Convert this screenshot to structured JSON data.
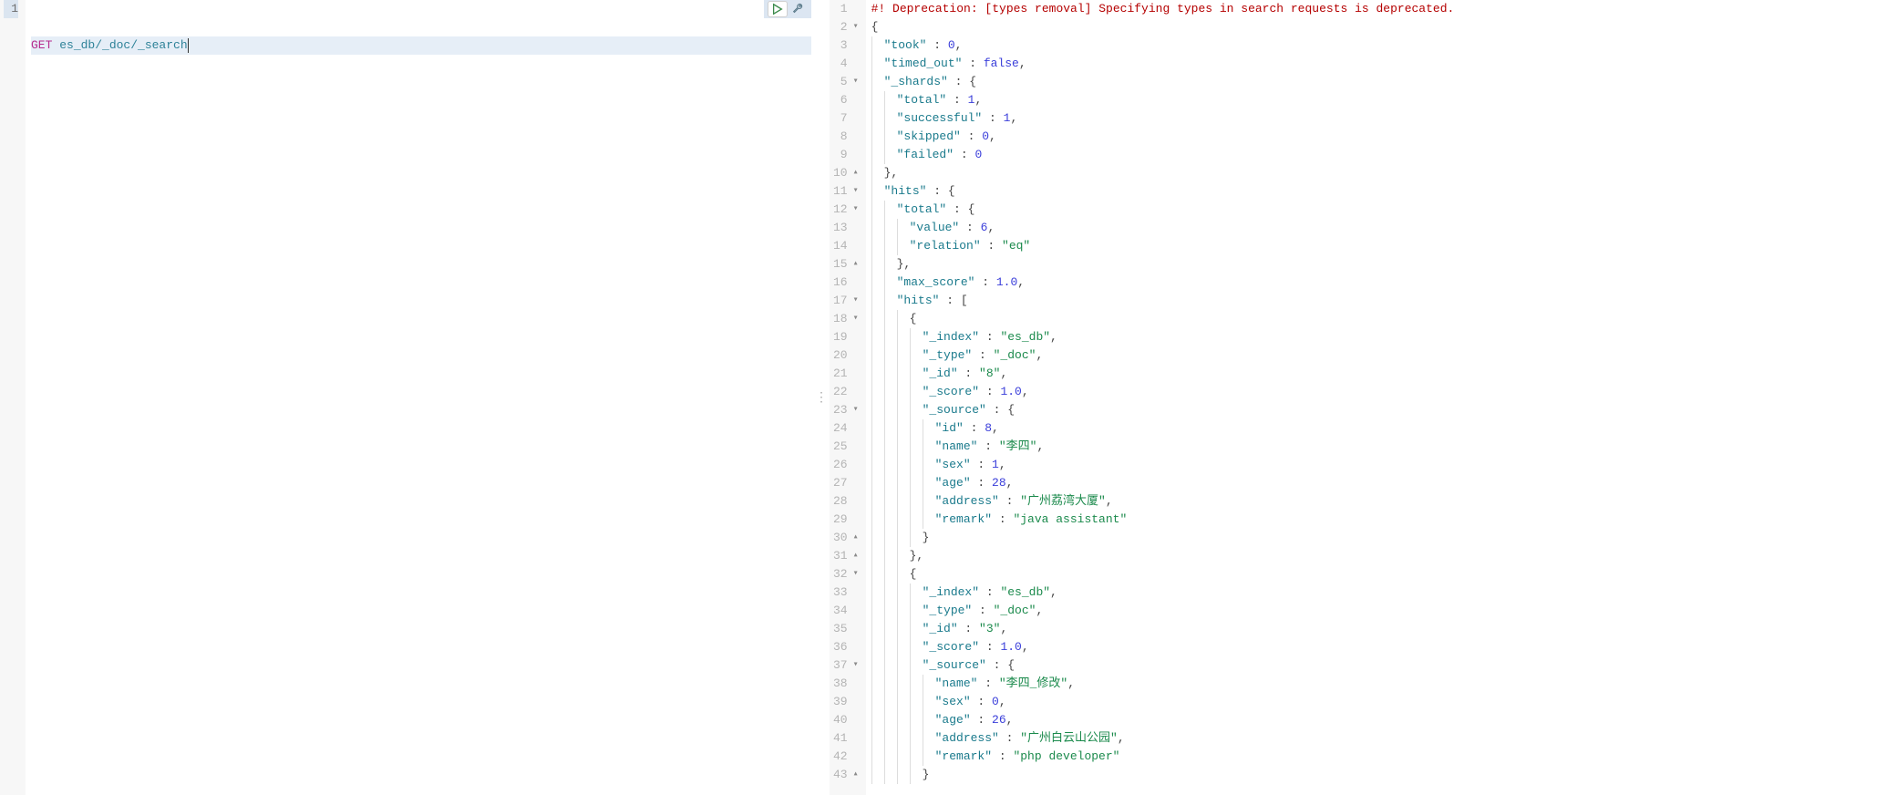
{
  "request": {
    "method": "GET",
    "path": "es_db/_doc/_search"
  },
  "actions": {
    "run": "run-request",
    "wrench": "open-options"
  },
  "responseLines": [
    {
      "n": 1,
      "fold": "",
      "indent": 0,
      "segs": [
        {
          "t": "#! Deprecation: [types removal] Specifying types in search requests is deprecated.",
          "c": "tok-err"
        }
      ]
    },
    {
      "n": 2,
      "fold": "▾",
      "indent": 0,
      "segs": [
        {
          "t": "{",
          "c": "tok-punc"
        }
      ]
    },
    {
      "n": 3,
      "fold": "",
      "indent": 1,
      "segs": [
        {
          "t": "\"took\"",
          "c": "tok-key"
        },
        {
          "t": " : ",
          "c": "tok-punc"
        },
        {
          "t": "0",
          "c": "tok-num"
        },
        {
          "t": ",",
          "c": "tok-punc"
        }
      ]
    },
    {
      "n": 4,
      "fold": "",
      "indent": 1,
      "segs": [
        {
          "t": "\"timed_out\"",
          "c": "tok-key"
        },
        {
          "t": " : ",
          "c": "tok-punc"
        },
        {
          "t": "false",
          "c": "tok-lit"
        },
        {
          "t": ",",
          "c": "tok-punc"
        }
      ]
    },
    {
      "n": 5,
      "fold": "▾",
      "indent": 1,
      "segs": [
        {
          "t": "\"_shards\"",
          "c": "tok-key"
        },
        {
          "t": " : ",
          "c": "tok-punc"
        },
        {
          "t": "{",
          "c": "tok-punc"
        }
      ]
    },
    {
      "n": 6,
      "fold": "",
      "indent": 2,
      "segs": [
        {
          "t": "\"total\"",
          "c": "tok-key"
        },
        {
          "t": " : ",
          "c": "tok-punc"
        },
        {
          "t": "1",
          "c": "tok-num"
        },
        {
          "t": ",",
          "c": "tok-punc"
        }
      ]
    },
    {
      "n": 7,
      "fold": "",
      "indent": 2,
      "segs": [
        {
          "t": "\"successful\"",
          "c": "tok-key"
        },
        {
          "t": " : ",
          "c": "tok-punc"
        },
        {
          "t": "1",
          "c": "tok-num"
        },
        {
          "t": ",",
          "c": "tok-punc"
        }
      ]
    },
    {
      "n": 8,
      "fold": "",
      "indent": 2,
      "segs": [
        {
          "t": "\"skipped\"",
          "c": "tok-key"
        },
        {
          "t": " : ",
          "c": "tok-punc"
        },
        {
          "t": "0",
          "c": "tok-num"
        },
        {
          "t": ",",
          "c": "tok-punc"
        }
      ]
    },
    {
      "n": 9,
      "fold": "",
      "indent": 2,
      "segs": [
        {
          "t": "\"failed\"",
          "c": "tok-key"
        },
        {
          "t": " : ",
          "c": "tok-punc"
        },
        {
          "t": "0",
          "c": "tok-num"
        }
      ]
    },
    {
      "n": 10,
      "fold": "▴",
      "indent": 1,
      "segs": [
        {
          "t": "}",
          "c": "tok-punc"
        },
        {
          "t": ",",
          "c": "tok-punc"
        }
      ]
    },
    {
      "n": 11,
      "fold": "▾",
      "indent": 1,
      "segs": [
        {
          "t": "\"hits\"",
          "c": "tok-key"
        },
        {
          "t": " : ",
          "c": "tok-punc"
        },
        {
          "t": "{",
          "c": "tok-punc"
        }
      ]
    },
    {
      "n": 12,
      "fold": "▾",
      "indent": 2,
      "segs": [
        {
          "t": "\"total\"",
          "c": "tok-key"
        },
        {
          "t": " : ",
          "c": "tok-punc"
        },
        {
          "t": "{",
          "c": "tok-punc"
        }
      ]
    },
    {
      "n": 13,
      "fold": "",
      "indent": 3,
      "segs": [
        {
          "t": "\"value\"",
          "c": "tok-key"
        },
        {
          "t": " : ",
          "c": "tok-punc"
        },
        {
          "t": "6",
          "c": "tok-num"
        },
        {
          "t": ",",
          "c": "tok-punc"
        }
      ]
    },
    {
      "n": 14,
      "fold": "",
      "indent": 3,
      "segs": [
        {
          "t": "\"relation\"",
          "c": "tok-key"
        },
        {
          "t": " : ",
          "c": "tok-punc"
        },
        {
          "t": "\"eq\"",
          "c": "tok-str"
        }
      ]
    },
    {
      "n": 15,
      "fold": "▴",
      "indent": 2,
      "segs": [
        {
          "t": "}",
          "c": "tok-punc"
        },
        {
          "t": ",",
          "c": "tok-punc"
        }
      ]
    },
    {
      "n": 16,
      "fold": "",
      "indent": 2,
      "segs": [
        {
          "t": "\"max_score\"",
          "c": "tok-key"
        },
        {
          "t": " : ",
          "c": "tok-punc"
        },
        {
          "t": "1.0",
          "c": "tok-num"
        },
        {
          "t": ",",
          "c": "tok-punc"
        }
      ]
    },
    {
      "n": 17,
      "fold": "▾",
      "indent": 2,
      "segs": [
        {
          "t": "\"hits\"",
          "c": "tok-key"
        },
        {
          "t": " : ",
          "c": "tok-punc"
        },
        {
          "t": "[",
          "c": "tok-punc"
        }
      ]
    },
    {
      "n": 18,
      "fold": "▾",
      "indent": 3,
      "segs": [
        {
          "t": "{",
          "c": "tok-punc"
        }
      ]
    },
    {
      "n": 19,
      "fold": "",
      "indent": 4,
      "segs": [
        {
          "t": "\"_index\"",
          "c": "tok-key"
        },
        {
          "t": " : ",
          "c": "tok-punc"
        },
        {
          "t": "\"es_db\"",
          "c": "tok-str"
        },
        {
          "t": ",",
          "c": "tok-punc"
        }
      ]
    },
    {
      "n": 20,
      "fold": "",
      "indent": 4,
      "segs": [
        {
          "t": "\"_type\"",
          "c": "tok-key"
        },
        {
          "t": " : ",
          "c": "tok-punc"
        },
        {
          "t": "\"_doc\"",
          "c": "tok-str"
        },
        {
          "t": ",",
          "c": "tok-punc"
        }
      ]
    },
    {
      "n": 21,
      "fold": "",
      "indent": 4,
      "segs": [
        {
          "t": "\"_id\"",
          "c": "tok-key"
        },
        {
          "t": " : ",
          "c": "tok-punc"
        },
        {
          "t": "\"8\"",
          "c": "tok-str"
        },
        {
          "t": ",",
          "c": "tok-punc"
        }
      ]
    },
    {
      "n": 22,
      "fold": "",
      "indent": 4,
      "segs": [
        {
          "t": "\"_score\"",
          "c": "tok-key"
        },
        {
          "t": " : ",
          "c": "tok-punc"
        },
        {
          "t": "1.0",
          "c": "tok-num"
        },
        {
          "t": ",",
          "c": "tok-punc"
        }
      ]
    },
    {
      "n": 23,
      "fold": "▾",
      "indent": 4,
      "segs": [
        {
          "t": "\"_source\"",
          "c": "tok-key"
        },
        {
          "t": " : ",
          "c": "tok-punc"
        },
        {
          "t": "{",
          "c": "tok-punc"
        }
      ]
    },
    {
      "n": 24,
      "fold": "",
      "indent": 5,
      "segs": [
        {
          "t": "\"id\"",
          "c": "tok-key"
        },
        {
          "t": " : ",
          "c": "tok-punc"
        },
        {
          "t": "8",
          "c": "tok-num"
        },
        {
          "t": ",",
          "c": "tok-punc"
        }
      ]
    },
    {
      "n": 25,
      "fold": "",
      "indent": 5,
      "segs": [
        {
          "t": "\"name\"",
          "c": "tok-key"
        },
        {
          "t": " : ",
          "c": "tok-punc"
        },
        {
          "t": "\"李四\"",
          "c": "tok-str"
        },
        {
          "t": ",",
          "c": "tok-punc"
        }
      ]
    },
    {
      "n": 26,
      "fold": "",
      "indent": 5,
      "segs": [
        {
          "t": "\"sex\"",
          "c": "tok-key"
        },
        {
          "t": " : ",
          "c": "tok-punc"
        },
        {
          "t": "1",
          "c": "tok-num"
        },
        {
          "t": ",",
          "c": "tok-punc"
        }
      ]
    },
    {
      "n": 27,
      "fold": "",
      "indent": 5,
      "segs": [
        {
          "t": "\"age\"",
          "c": "tok-key"
        },
        {
          "t": " : ",
          "c": "tok-punc"
        },
        {
          "t": "28",
          "c": "tok-num"
        },
        {
          "t": ",",
          "c": "tok-punc"
        }
      ]
    },
    {
      "n": 28,
      "fold": "",
      "indent": 5,
      "segs": [
        {
          "t": "\"address\"",
          "c": "tok-key"
        },
        {
          "t": " : ",
          "c": "tok-punc"
        },
        {
          "t": "\"广州荔湾大厦\"",
          "c": "tok-str"
        },
        {
          "t": ",",
          "c": "tok-punc"
        }
      ]
    },
    {
      "n": 29,
      "fold": "",
      "indent": 5,
      "segs": [
        {
          "t": "\"remark\"",
          "c": "tok-key"
        },
        {
          "t": " : ",
          "c": "tok-punc"
        },
        {
          "t": "\"java assistant\"",
          "c": "tok-str"
        }
      ]
    },
    {
      "n": 30,
      "fold": "▴",
      "indent": 4,
      "segs": [
        {
          "t": "}",
          "c": "tok-punc"
        }
      ]
    },
    {
      "n": 31,
      "fold": "▴",
      "indent": 3,
      "segs": [
        {
          "t": "}",
          "c": "tok-punc"
        },
        {
          "t": ",",
          "c": "tok-punc"
        }
      ]
    },
    {
      "n": 32,
      "fold": "▾",
      "indent": 3,
      "segs": [
        {
          "t": "{",
          "c": "tok-punc"
        }
      ]
    },
    {
      "n": 33,
      "fold": "",
      "indent": 4,
      "segs": [
        {
          "t": "\"_index\"",
          "c": "tok-key"
        },
        {
          "t": " : ",
          "c": "tok-punc"
        },
        {
          "t": "\"es_db\"",
          "c": "tok-str"
        },
        {
          "t": ",",
          "c": "tok-punc"
        }
      ]
    },
    {
      "n": 34,
      "fold": "",
      "indent": 4,
      "segs": [
        {
          "t": "\"_type\"",
          "c": "tok-key"
        },
        {
          "t": " : ",
          "c": "tok-punc"
        },
        {
          "t": "\"_doc\"",
          "c": "tok-str"
        },
        {
          "t": ",",
          "c": "tok-punc"
        }
      ]
    },
    {
      "n": 35,
      "fold": "",
      "indent": 4,
      "segs": [
        {
          "t": "\"_id\"",
          "c": "tok-key"
        },
        {
          "t": " : ",
          "c": "tok-punc"
        },
        {
          "t": "\"3\"",
          "c": "tok-str"
        },
        {
          "t": ",",
          "c": "tok-punc"
        }
      ]
    },
    {
      "n": 36,
      "fold": "",
      "indent": 4,
      "segs": [
        {
          "t": "\"_score\"",
          "c": "tok-key"
        },
        {
          "t": " : ",
          "c": "tok-punc"
        },
        {
          "t": "1.0",
          "c": "tok-num"
        },
        {
          "t": ",",
          "c": "tok-punc"
        }
      ]
    },
    {
      "n": 37,
      "fold": "▾",
      "indent": 4,
      "segs": [
        {
          "t": "\"_source\"",
          "c": "tok-key"
        },
        {
          "t": " : ",
          "c": "tok-punc"
        },
        {
          "t": "{",
          "c": "tok-punc"
        }
      ]
    },
    {
      "n": 38,
      "fold": "",
      "indent": 5,
      "segs": [
        {
          "t": "\"name\"",
          "c": "tok-key"
        },
        {
          "t": " : ",
          "c": "tok-punc"
        },
        {
          "t": "\"李四_修改\"",
          "c": "tok-str"
        },
        {
          "t": ",",
          "c": "tok-punc"
        }
      ]
    },
    {
      "n": 39,
      "fold": "",
      "indent": 5,
      "segs": [
        {
          "t": "\"sex\"",
          "c": "tok-key"
        },
        {
          "t": " : ",
          "c": "tok-punc"
        },
        {
          "t": "0",
          "c": "tok-num"
        },
        {
          "t": ",",
          "c": "tok-punc"
        }
      ]
    },
    {
      "n": 40,
      "fold": "",
      "indent": 5,
      "segs": [
        {
          "t": "\"age\"",
          "c": "tok-key"
        },
        {
          "t": " : ",
          "c": "tok-punc"
        },
        {
          "t": "26",
          "c": "tok-num"
        },
        {
          "t": ",",
          "c": "tok-punc"
        }
      ]
    },
    {
      "n": 41,
      "fold": "",
      "indent": 5,
      "segs": [
        {
          "t": "\"address\"",
          "c": "tok-key"
        },
        {
          "t": " : ",
          "c": "tok-punc"
        },
        {
          "t": "\"广州白云山公园\"",
          "c": "tok-str"
        },
        {
          "t": ",",
          "c": "tok-punc"
        }
      ]
    },
    {
      "n": 42,
      "fold": "",
      "indent": 5,
      "segs": [
        {
          "t": "\"remark\"",
          "c": "tok-key"
        },
        {
          "t": " : ",
          "c": "tok-punc"
        },
        {
          "t": "\"php developer\"",
          "c": "tok-str"
        }
      ]
    },
    {
      "n": 43,
      "fold": "▴",
      "indent": 4,
      "segs": [
        {
          "t": "}",
          "c": "tok-punc"
        }
      ]
    }
  ]
}
